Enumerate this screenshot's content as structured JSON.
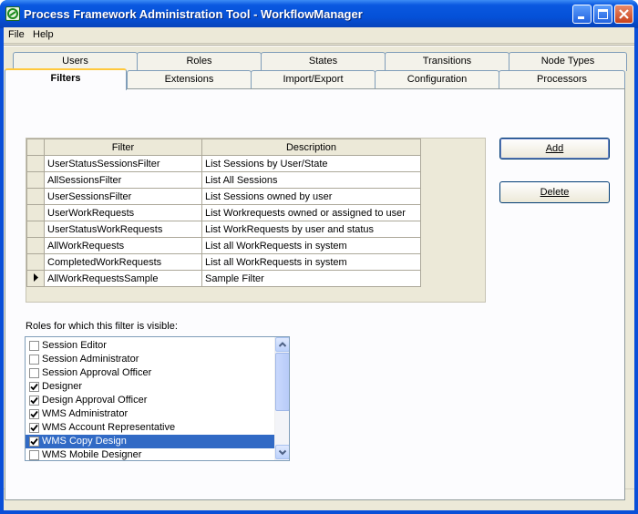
{
  "window": {
    "title": "Process Framework Administration Tool - WorkflowManager"
  },
  "menu": [
    "File",
    "Help"
  ],
  "tabs_row1": [
    "Users",
    "Roles",
    "States",
    "Transitions",
    "Node Types"
  ],
  "tabs_row2": [
    "Filters",
    "Extensions",
    "Import/Export",
    "Configuration",
    "Processors"
  ],
  "active_tab": "Filters",
  "grid": {
    "columns": [
      "Filter",
      "Description"
    ],
    "rows": [
      {
        "filter": "UserStatusSessionsFilter",
        "description": "List Sessions by User/State"
      },
      {
        "filter": "AllSessionsFilter",
        "description": "List All Sessions"
      },
      {
        "filter": "UserSessionsFilter",
        "description": "List Sessions owned by user"
      },
      {
        "filter": "UserWorkRequests",
        "description": "List Workrequests owned or assigned to user"
      },
      {
        "filter": "UserStatusWorkRequests",
        "description": "List WorkRequests by user and status"
      },
      {
        "filter": "AllWorkRequests",
        "description": "List all WorkRequests in system"
      },
      {
        "filter": "CompletedWorkRequests",
        "description": "List all WorkRequests in system"
      },
      {
        "filter": "AllWorkRequestsSample",
        "description": "Sample Filter"
      }
    ],
    "current_row_index": 7
  },
  "buttons": {
    "add": "Add",
    "delete": "Delete"
  },
  "roles": {
    "label": "Roles for which this filter is visible:",
    "items": [
      {
        "name": "Session Editor",
        "checked": false
      },
      {
        "name": "Session Administrator",
        "checked": false
      },
      {
        "name": "Session Approval Officer",
        "checked": false
      },
      {
        "name": "Designer",
        "checked": true
      },
      {
        "name": "Design Approval Officer",
        "checked": true
      },
      {
        "name": "WMS Administrator",
        "checked": true
      },
      {
        "name": "WMS Account Representative",
        "checked": true
      },
      {
        "name": "WMS Copy Design",
        "checked": true,
        "selected": true
      },
      {
        "name": "WMS Mobile Designer",
        "checked": false
      }
    ]
  },
  "colors": {
    "titlebar": "#0551d8",
    "selection": "#316ac5",
    "tab_highlight": "#ffc83c"
  }
}
